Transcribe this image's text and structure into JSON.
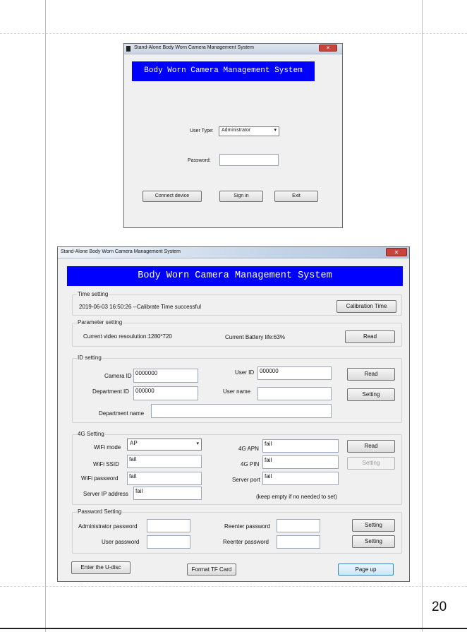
{
  "page": {
    "number": "20"
  },
  "login_window": {
    "title": "Stand-Alone Body Worn Camera Management System",
    "close_glyph": "✕",
    "banner": "Body Worn Camera Management System",
    "user_type_label": "User Type:",
    "user_type_value": "Administrator",
    "password_label": "Password:",
    "password_value": "",
    "buttons": {
      "connect": "Connect device",
      "sign_in": "Sign in",
      "exit": "Exit"
    }
  },
  "main_window": {
    "title": "Stand-Alone Body Worn Camera Management System",
    "close_glyph": "✕",
    "banner": "Body Worn Camera Management System",
    "time_setting": {
      "title": "Time setting",
      "status": "2019-06-03 16:50:26 --Calibrate Time successful",
      "button": "Calibration Time"
    },
    "parameter_setting": {
      "title": "Parameter setting",
      "resolution": "Current video resoulution:1280*720",
      "battery": "Current Battery life:63%",
      "button": "Read"
    },
    "id_setting": {
      "title": "ID setting",
      "camera_id_label": "Camera ID",
      "camera_id_value": "0000000",
      "user_id_label": "User ID",
      "user_id_value": "000000",
      "department_id_label": "Department ID",
      "department_id_value": "000000",
      "user_name_label": "User name",
      "user_name_value": "",
      "department_name_label": "Department name",
      "department_name_value": "",
      "read_button": "Read",
      "setting_button": "Setting"
    },
    "g4_setting": {
      "title": "4G Setting",
      "wifi_mode_label": "WiFi mode",
      "wifi_mode_value": "AP",
      "wifi_ssid_label": "WiFi SSID",
      "wifi_ssid_value": "fail",
      "wifi_password_label": "WiFi password",
      "wifi_password_value": "fail",
      "server_ip_label": "Server IP address",
      "server_ip_value": "fail",
      "apn_label": "4G APN",
      "apn_value": "fail",
      "pin_label": "4G PIN",
      "pin_value": "fail",
      "server_port_label": "Server port",
      "server_port_value": "fail",
      "note": "(keep empty if no needed to set)",
      "read_button": "Read",
      "setting_button": "Setting"
    },
    "password_setting": {
      "title": "Password Setting",
      "admin_password_label": "Administrator password",
      "user_password_label": "User password",
      "reenter_label_1": "Reenter password",
      "reenter_label_2": "Reenter password",
      "setting_button_1": "Setting",
      "setting_button_2": "Setting"
    },
    "footer": {
      "udisc_button": "Enter the U-disc",
      "format_button": "Format TF Card",
      "page_up_button": "Page up"
    }
  }
}
